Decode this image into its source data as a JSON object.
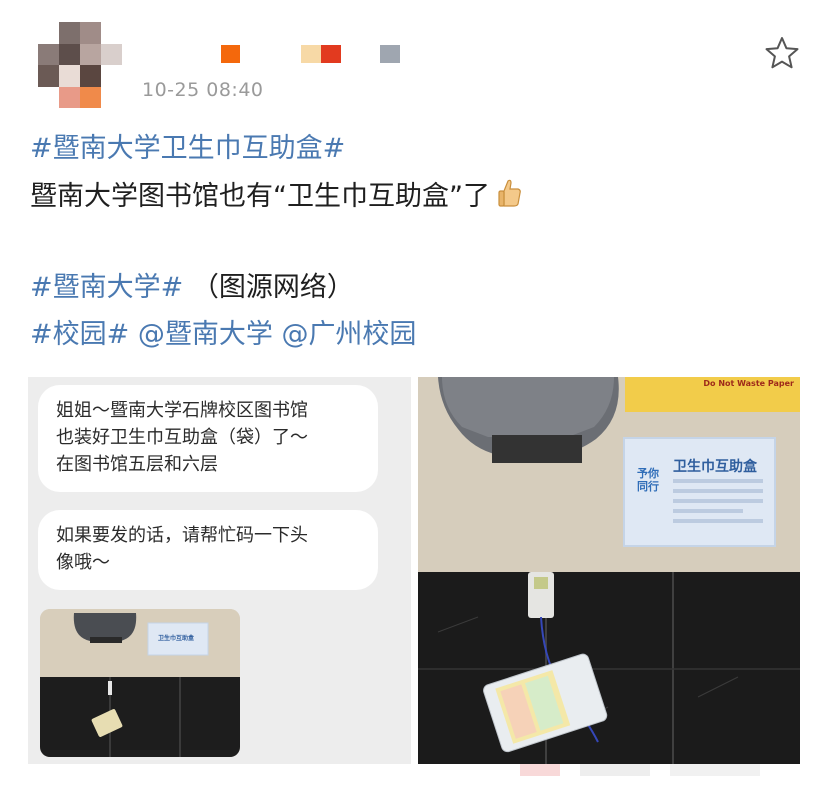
{
  "post": {
    "timestamp": "10-25 08:40",
    "line1_tag": "#暨南大学卫生巾互助盒#",
    "line2_text": "暨南大学图书馆也有“卫生巾互助盒”了",
    "line2_emoji": "thumbs-up-icon",
    "line4_tag": "#暨南大学#",
    "line4_text": "（图源网络）",
    "line5_tag1": "#校园#",
    "line5_mention1": "@暨南大学",
    "line5_mention2": "@广州校园"
  },
  "image_left": {
    "bubble1": [
      "姐姐～暨南大学石牌校区图书馆",
      "也装好卫生巾互助盒（袋）了～",
      "在图书馆五层和六层"
    ],
    "bubble2": [
      "如果要发的话，请帮忙码一下头",
      "像哦～"
    ],
    "mini_sign": "卫生巾互助盒"
  },
  "image_right": {
    "sign_title": "卫生巾互助盒",
    "sign_logo": "予你同行",
    "paper_sign": "Do Not Waste Paper"
  },
  "colors": {
    "link": "#4a79b1",
    "text": "#1f1f1f",
    "timestamp": "#9a9a9a"
  },
  "icons": {
    "favorite": "star-outline-icon"
  }
}
